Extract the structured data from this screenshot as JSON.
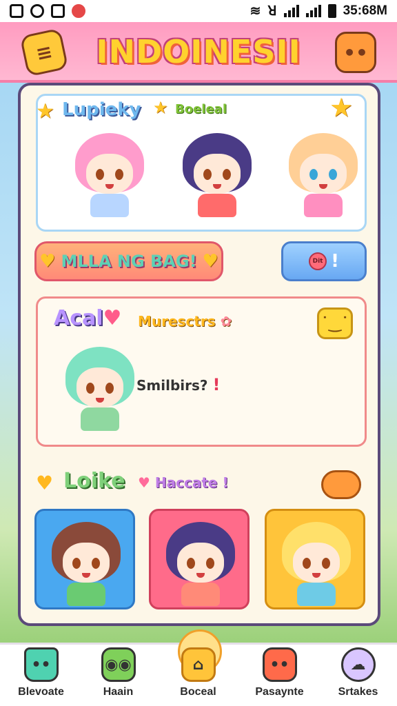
{
  "status_bar": {
    "time": "35:68M",
    "left_icons": [
      "app-icon",
      "gmail-icon",
      "flag-icon",
      "notification-icon"
    ],
    "right_icons": [
      "wifi-icon",
      "nfc-icon",
      "signal-icon",
      "signal-icon",
      "battery-icon"
    ]
  },
  "header": {
    "title": "INDOINESII",
    "left_button_icon": "chat-icon",
    "right_button_icon": "character-icon"
  },
  "section_top": {
    "label_left": "Lupieky",
    "label_right": "Boeleal",
    "characters": [
      "pink-hair-girl",
      "purple-hair-boy",
      "blonde-hair-girl"
    ]
  },
  "actions": {
    "pill_label": "MLLA NG BAG!",
    "blue_button_badge": "Dit",
    "blue_button_text": "!"
  },
  "section_middle": {
    "label_left": "Acal",
    "label_right": "Muresctrs",
    "message": "Smilbirs?",
    "message_mark": "!"
  },
  "section_bottom": {
    "label_left": "Loike",
    "label_right": "Haccate",
    "label_right_mark": "!",
    "tiles": [
      "brown-hair-character",
      "purple-hair-character",
      "blonde-hair-character"
    ]
  },
  "bottom_nav": {
    "items": [
      {
        "label": "Blevoate",
        "icon": "house-monster-icon"
      },
      {
        "label": "Haain",
        "icon": "frog-icon"
      },
      {
        "label": "Boceal",
        "icon": "home-icon"
      },
      {
        "label": "Pasaynte",
        "icon": "bear-icon"
      },
      {
        "label": "Srtakes",
        "icon": "cloud-icon"
      }
    ],
    "active_index": 2
  },
  "colors": {
    "header_pink": "#ff9cc0",
    "card_bg": "#fdf7e8",
    "title_yellow": "#ffd22e"
  }
}
